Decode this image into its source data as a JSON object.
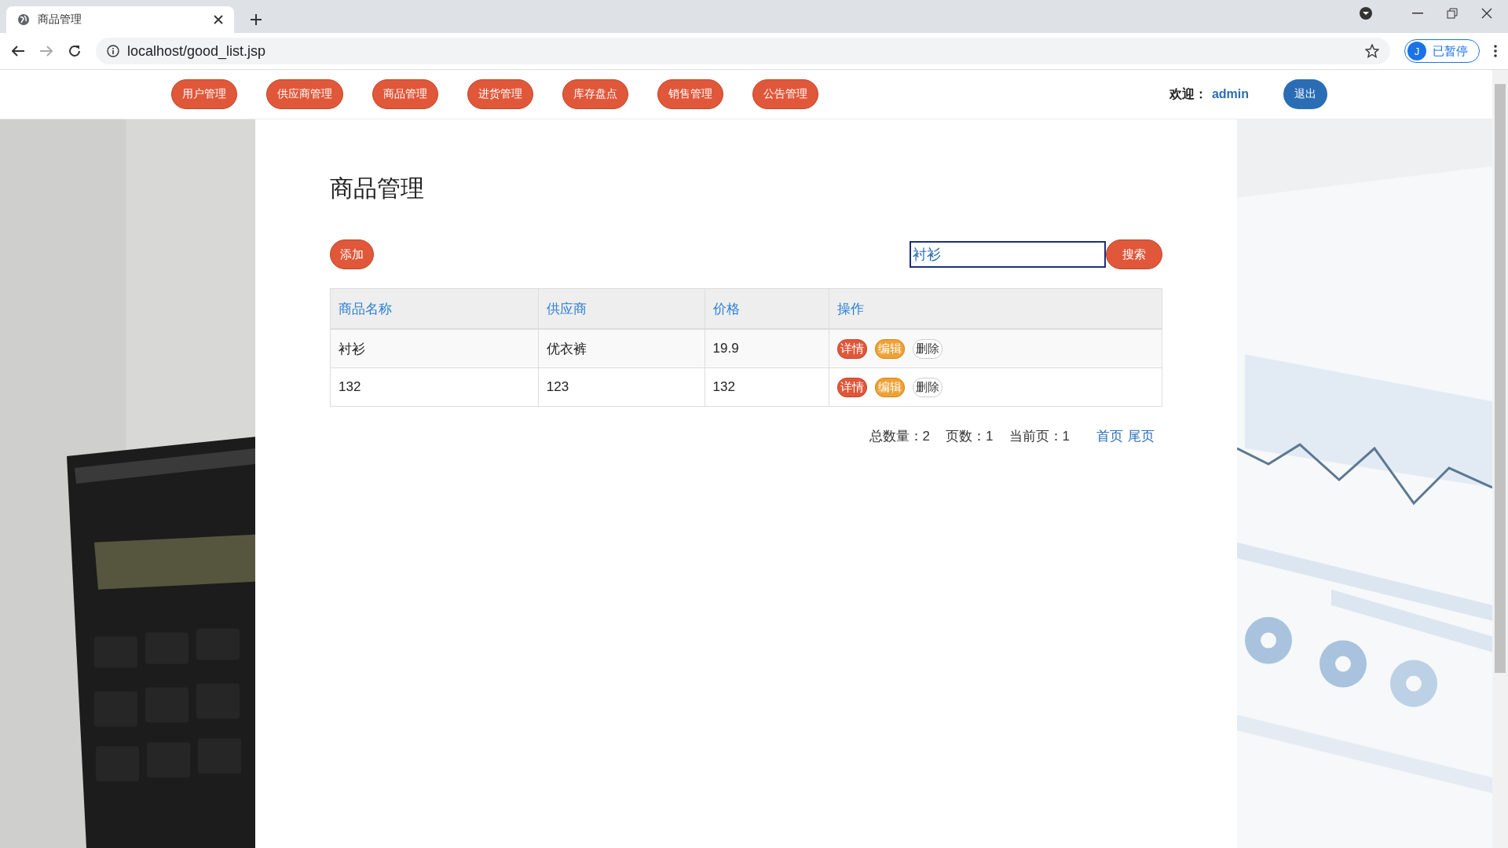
{
  "browser": {
    "tab_title": "商品管理",
    "url": "localhost/good_list.jsp",
    "profile_initial": "J",
    "profile_label": "已暂停"
  },
  "nav": {
    "items": [
      "用户管理",
      "供应商管理",
      "商品管理",
      "进货管理",
      "库存盘点",
      "销售管理",
      "公告管理"
    ],
    "welcome_label": "欢迎：",
    "user": "admin",
    "logout": "退出"
  },
  "page": {
    "title": "商品管理",
    "add_button": "添加",
    "search": {
      "value": "衬衫",
      "button": "搜索"
    },
    "table": {
      "columns": [
        "商品名称",
        "供应商",
        "价格",
        "操作"
      ],
      "rows": [
        {
          "cells": [
            "衬衫",
            "优衣裤",
            "19.9"
          ],
          "actions": [
            {
              "kind": "detail",
              "label": "详情"
            },
            {
              "kind": "edit",
              "label": "编辑"
            },
            {
              "kind": "delete",
              "label": "删除"
            }
          ]
        },
        {
          "cells": [
            "132",
            "123",
            "132"
          ],
          "actions": [
            {
              "kind": "detail",
              "label": "详情"
            },
            {
              "kind": "edit",
              "label": "编辑"
            },
            {
              "kind": "delete",
              "label": "删除"
            }
          ]
        }
      ]
    },
    "pagination": {
      "total": "总数量：2",
      "pages": "页数：1",
      "current": "当前页：1",
      "first": "首页",
      "last": "尾页"
    }
  }
}
